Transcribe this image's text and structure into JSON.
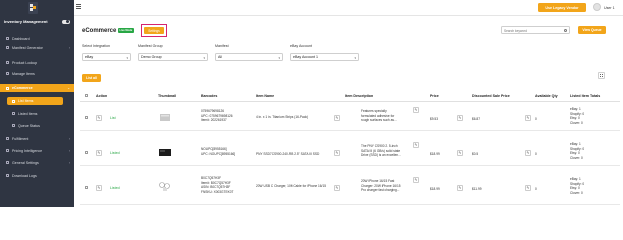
{
  "sidebar": {
    "inventory_label": "Inventory Management",
    "items": [
      {
        "label": "Dashboard",
        "icon": "dashboard-icon"
      },
      {
        "label": "Manifest Generator",
        "icon": "document-icon"
      },
      {
        "label": "Product Lookup",
        "icon": "search-icon"
      },
      {
        "label": "Manage Items",
        "icon": "box-icon"
      },
      {
        "label": "eCommerce",
        "icon": "cart-icon"
      },
      {
        "label": "List Items",
        "icon": "list-icon"
      },
      {
        "label": "Listed Items",
        "icon": "tag-icon"
      },
      {
        "label": "Queue Status",
        "icon": "queue-icon"
      },
      {
        "label": "Fulfillment",
        "icon": "truck-icon"
      },
      {
        "label": "Pricing Intelligence",
        "icon": "chart-icon"
      },
      {
        "label": "General Settings",
        "icon": "gear-icon"
      },
      {
        "label": "Download Logs",
        "icon": "download-icon"
      }
    ]
  },
  "topbar": {
    "legacy_button": "Use Legacy Vendor",
    "user_label": "User 1"
  },
  "header": {
    "title": "eCommerce",
    "badge": "Live Mode",
    "settings_button": "Settings",
    "search_placeholder": "Search keyword",
    "view_queue_button": "View Queue"
  },
  "filters": {
    "integration": {
      "label": "Select Integration",
      "value": "eBay"
    },
    "managed_group": {
      "label": "Manifest Group",
      "value": "Demo Group"
    },
    "manifest": {
      "label": "Manifest",
      "value": "All"
    },
    "ebay_account": {
      "label": "eBay Account",
      "value": "eBay Account 1"
    }
  },
  "list_all_button": "List all",
  "table": {
    "columns": [
      "Action",
      "Thumbnail",
      "Barcodes",
      "Item Name",
      "Item Description",
      "Price",
      "Discounted Sale Price",
      "Available Qty",
      "Listed Item Totals"
    ],
    "rows": [
      {
        "status": "List",
        "barcodes": [
          "0759679698126",
          "UPC: 0759679698126",
          "Item#: 202261937"
        ],
        "name": "4 in. x 1 in. Titanium Strips (16-Pack)",
        "description": [
          "Features specially",
          "formulated adhesive for",
          "rough surfaces such as..."
        ],
        "price": "$9.53",
        "discounted": "$6.87",
        "qty": "0",
        "totals": [
          "eBay: 1",
          "Shopify: 0",
          "Etsy: 0",
          "Clover: 0"
        ]
      },
      {
        "status": "Listed",
        "barcodes": [
          "NOUPC[8955166]",
          "UPC: NOUPC[8955166]"
        ],
        "name": "PNY SSD7CS900-240-RB 2.5\" SATA III SSD",
        "description": [
          "The PNY CS900 2. 5-inch",
          "SATA III (6 GB/s) solid state",
          "Drive (SSD) is an excellen..."
        ],
        "price": "$18.99",
        "discounted": "$0.5",
        "qty": "0",
        "totals": [
          "eBay: 1",
          "Shopify: 0",
          "Etsy: 0",
          "Clover: 0"
        ]
      },
      {
        "status": "Listed",
        "barcodes": [
          "B0C7Q57H3F",
          "Item#: B0C7Q57H3F",
          "ASIN: B0C7Q57H3F",
          "FNSKU: X003GTEK0T"
        ],
        "name": "20W USB C Charger, 10ft Cable for iPhone 16/15",
        "description": [
          "20W iPhone 16/15 Fast",
          "Charger: 20W iPhone 16/15",
          "Pro charger fast charging..."
        ],
        "price": "$18.99",
        "discounted": "$11.99",
        "qty": "0",
        "totals": [
          "eBay: 1",
          "Shopify: 0",
          "Etsy: 0",
          "Clover: 0"
        ]
      }
    ]
  },
  "colors": {
    "accent": "#f2a51a",
    "sidebar_bg": "#2f3542",
    "live": "#28a745",
    "highlight": "#d6246e"
  }
}
